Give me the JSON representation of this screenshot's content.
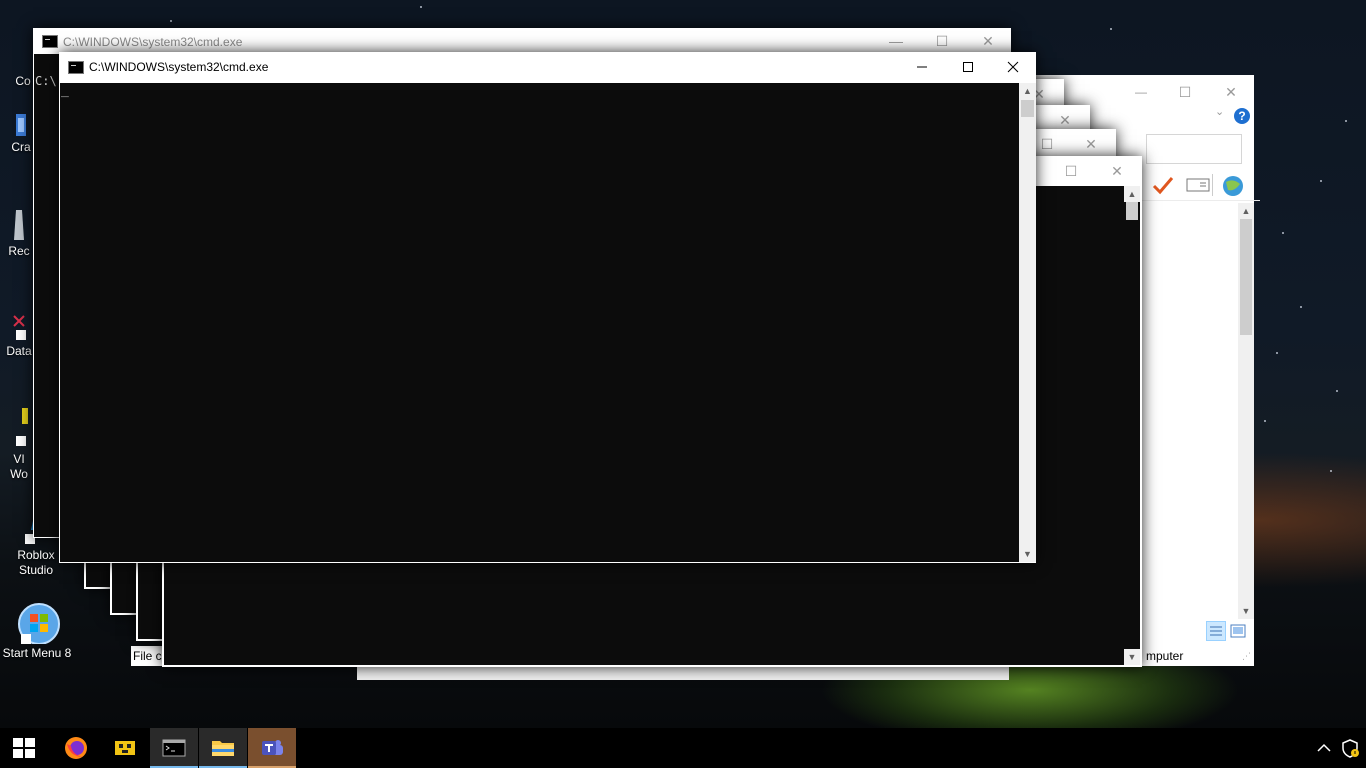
{
  "desktop": {
    "icons": [
      {
        "label": "Co",
        "name": "desktop-icon-control"
      },
      {
        "label": "Cra",
        "name": "desktop-icon-crash"
      },
      {
        "label": "Rec",
        "name": "desktop-icon-recycle"
      },
      {
        "label": "Data",
        "name": "desktop-icon-data"
      },
      {
        "label": "VI\nWo",
        "name": "desktop-icon-vi-wo"
      },
      {
        "label": "Roblox\nStudio",
        "name": "desktop-icon-roblox-studio"
      },
      {
        "label": "Start Menu 8",
        "name": "desktop-icon-start-menu-8"
      }
    ]
  },
  "back_window": {
    "status_left": "File c",
    "status_right": "mputer"
  },
  "cmd_back": {
    "title": "C:\\WINDOWS\\system32\\cmd.exe",
    "console_text": "C:\\"
  },
  "cmd_front": {
    "title": "C:\\WINDOWS\\system32\\cmd.exe",
    "cursor": "_"
  },
  "help_button": "?",
  "taskbar": {
    "items": [
      "start",
      "firefox",
      "app-yellow",
      "command-prompt",
      "file-explorer",
      "microsoft-teams"
    ],
    "tray_chevron": "^"
  },
  "colors": {
    "console_bg": "#0c0c0c",
    "taskbar_bg": "#000000",
    "accent_active": "#76b9ed",
    "teams_active": "#7a4f2e"
  }
}
